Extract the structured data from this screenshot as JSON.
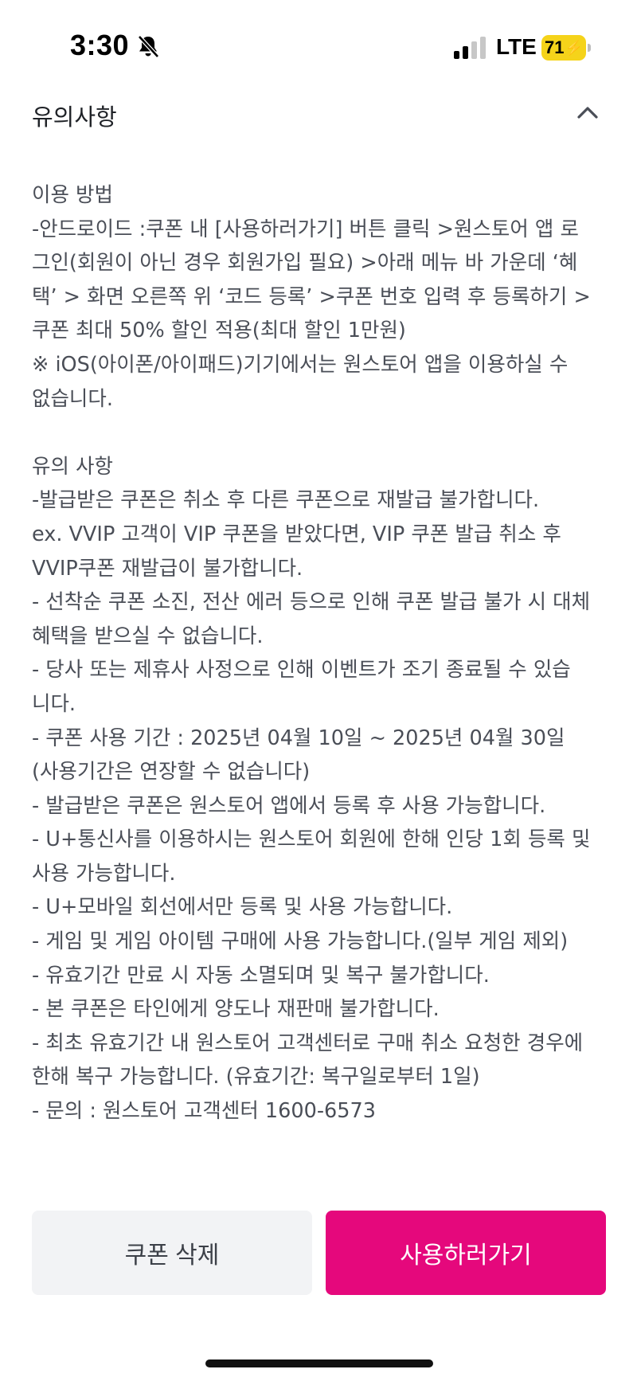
{
  "status_bar": {
    "time": "3:30",
    "network": "LTE",
    "battery": "71",
    "icons": [
      "bell-slash-icon",
      "signal-icon",
      "battery-charging-icon"
    ]
  },
  "header": {
    "title": "유의사항",
    "toggle_icon": "chevron-up-icon"
  },
  "notice": {
    "lines": [
      "이용 방법",
      "-안드로이드 :쿠폰 내 [사용하러가기] 버튼 클릭 >원스토어 앱 로",
      "그인(회원이 아닌 경우 회원가입 필요) >아래 메뉴 바 가운데 ‘혜",
      "택’ > 화면 오른쪽 위 ‘코드 등록’ >쿠폰 번호 입력 후 등록하기 >",
      "쿠폰 최대 50% 할인 적용(최대 할인 1만원)",
      " ※ iOS(아이폰/아이패드)기기에서는 원스토어 앱을 이용하실 수",
      "없습니다.",
      "",
      "유의 사항",
      "-발급받은 쿠폰은 취소 후 다른 쿠폰으로 재발급 불가합니다.",
      "ex. VVIP 고객이 VIP 쿠폰을 받았다면, VIP 쿠폰 발급 취소 후",
      "VVIP쿠폰 재발급이 불가합니다.",
      "- 선착순 쿠폰 소진, 전산 에러 등으로 인해 쿠폰 발급 불가 시 대체",
      "혜택을 받으실 수 없습니다.",
      "- 당사 또는 제휴사 사정으로 인해 이벤트가 조기 종료될 수 있습",
      "니다.",
      "- 쿠폰 사용 기간 : 2025년 04월 10일 ~ 2025년 04월 30일",
      "(사용기간은 연장할 수 없습니다)",
      "- 발급받은 쿠폰은 원스토어 앱에서 등록 후 사용 가능합니다.",
      "- U+통신사를 이용하시는 원스토어 회원에 한해 인당 1회 등록 및",
      "사용 가능합니다.",
      "- U+모바일 회선에서만 등록 및 사용 가능합니다.",
      "- 게임 및 게임 아이템 구매에 사용 가능합니다.(일부 게임 제외)",
      "- 유효기간 만료 시 자동 소멸되며 및 복구 불가합니다.",
      "- 본 쿠폰은 타인에게 양도나 재판매 불가합니다.",
      "- 최초 유효기간 내 원스토어 고객센터로 구매 취소 요청한 경우에",
      "한해 복구 가능합니다. (유효기간: 복구일로부터 1일)",
      "- 문의 : 원스토어 고객센터 1600-6573"
    ]
  },
  "actions": {
    "delete_label": "쿠폰 삭제",
    "use_label": "사용하러가기"
  },
  "colors": {
    "accent": "#e5087c",
    "secondary_button_bg": "#f2f3f5",
    "body_text": "#4a4e57",
    "battery": "#f5d31a"
  }
}
